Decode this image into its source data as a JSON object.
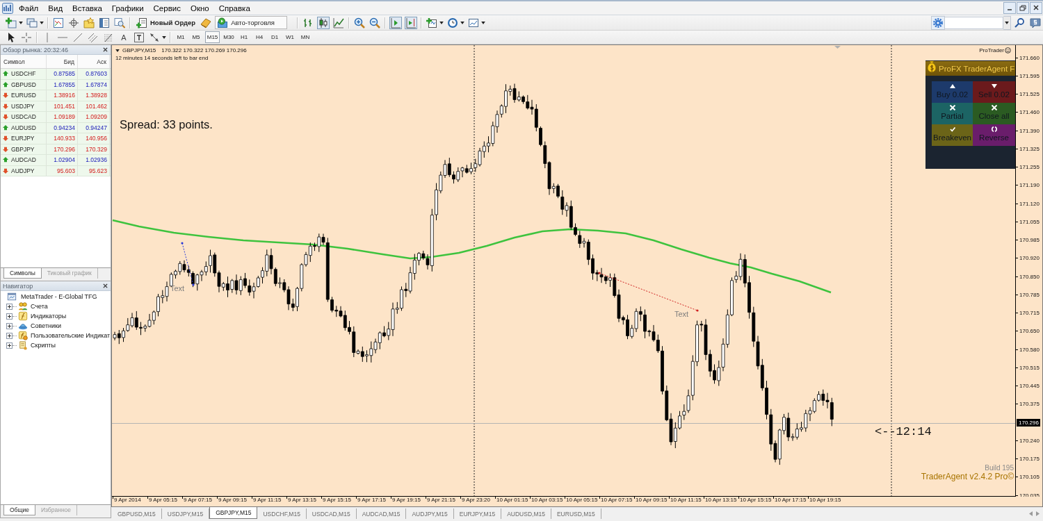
{
  "menu": [
    "Файл",
    "Вид",
    "Вставка",
    "Графики",
    "Сервис",
    "Окно",
    "Справка"
  ],
  "toolbar": {
    "new_order": "Новый Ордер",
    "auto_trading": "Авто-торговля",
    "chart_modes": [
      {
        "selected": false
      },
      {
        "selected": true
      },
      {
        "selected": false
      }
    ],
    "shift_on": true,
    "autoscroll_on": true,
    "text_tool": "A",
    "timeframes": [
      {
        "label": "M1",
        "selected": false
      },
      {
        "label": "M5",
        "selected": false
      },
      {
        "label": "M15",
        "selected": true
      },
      {
        "label": "M30",
        "selected": false
      },
      {
        "label": "H1",
        "selected": false
      },
      {
        "label": "H4",
        "selected": false
      },
      {
        "label": "D1",
        "selected": false
      },
      {
        "label": "W1",
        "selected": false
      },
      {
        "label": "MN",
        "selected": false
      }
    ]
  },
  "market_watch": {
    "title": "Обзор рынка: 20:32:46",
    "columns": [
      "Символ",
      "Бид",
      "Аск"
    ],
    "rows": [
      {
        "symbol": "USDCHF",
        "bid": "0.87585",
        "ask": "0.87603",
        "kind": "up"
      },
      {
        "symbol": "GBPUSD",
        "bid": "1.67855",
        "ask": "1.67874",
        "kind": "up"
      },
      {
        "symbol": "EURUSD",
        "bid": "1.38916",
        "ask": "1.38928",
        "kind": "down"
      },
      {
        "symbol": "USDJPY",
        "bid": "101.451",
        "ask": "101.462",
        "kind": "down"
      },
      {
        "symbol": "USDCAD",
        "bid": "1.09189",
        "ask": "1.09209",
        "kind": "down"
      },
      {
        "symbol": "AUDUSD",
        "bid": "0.94234",
        "ask": "0.94247",
        "kind": "up"
      },
      {
        "symbol": "EURJPY",
        "bid": "140.933",
        "ask": "140.956",
        "kind": "down"
      },
      {
        "symbol": "GBPJPY",
        "bid": "170.296",
        "ask": "170.329",
        "kind": "down"
      },
      {
        "symbol": "AUDCAD",
        "bid": "1.02904",
        "ask": "1.02936",
        "kind": "up"
      },
      {
        "symbol": "AUDJPY",
        "bid": "95.603",
        "ask": "95.623",
        "kind": "down"
      }
    ],
    "tabs": [
      {
        "label": "Символы",
        "selected": true
      },
      {
        "label": "Тиковый график",
        "selected": false
      }
    ]
  },
  "navigator": {
    "title": "Навигатор",
    "tree": [
      {
        "label": "MetaTrader - E-Global TFG",
        "children": [
          {
            "label": "Счета",
            "expanded": false
          },
          {
            "label": "Индикаторы",
            "expanded": false
          },
          {
            "label": "Советники",
            "expanded": false
          },
          {
            "label": "Пользовательские Индикат",
            "expanded": false
          },
          {
            "label": "Скрипты",
            "expanded": false
          }
        ]
      }
    ],
    "tabs": [
      {
        "label": "Общие",
        "selected": true
      },
      {
        "label": "Избранное",
        "selected": false
      }
    ]
  },
  "chart": {
    "symbol": "GBPJPY,M15",
    "ohlc": "170.322 170.322 170.269 170.296",
    "timer": "12 minutes 14 seconds left to bar end",
    "spread": "Spread: 33 points.",
    "countdown": "<--12:14",
    "brand": "ProTrader",
    "object_labels": [
      "Text",
      "Text"
    ],
    "price_scale": {
      "ticks_above": [
        "171.660",
        "171.595",
        "171.525",
        "171.460",
        "171.390",
        "171.325",
        "171.255",
        "171.190",
        "171.120",
        "171.055",
        "170.985",
        "170.920",
        "170.850",
        "170.785",
        "170.715",
        "170.650",
        "170.580",
        "170.515",
        "170.445",
        "170.375"
      ],
      "current_price": "170.296",
      "ticks_below": [
        "170.240",
        "170.175",
        "170.105",
        "170.035"
      ]
    },
    "time_labels": [
      "9 Apr 2014",
      "9 Apr 05:15",
      "9 Apr 07:15",
      "9 Apr 09:15",
      "9 Apr 11:15",
      "9 Apr 13:15",
      "9 Apr 15:15",
      "9 Apr 17:15",
      "9 Apr 19:15",
      "9 Apr 21:15",
      "9 Apr 23:20",
      "10 Apr 01:15",
      "10 Apr 03:15",
      "10 Apr 05:15",
      "10 Apr 07:15",
      "10 Apr 09:15",
      "10 Apr 11:15",
      "10 Apr 13:15",
      "10 Apr 15:15",
      "10 Apr 17:15",
      "10 Apr 19:15"
    ],
    "panel": {
      "title": "ProFX TraderAgent F",
      "buttons": [
        {
          "kind": "buy",
          "label": "Buy 0.02",
          "color": "#1d3a6b"
        },
        {
          "kind": "sell",
          "label": "Sell 0.02",
          "color": "#6b1a1c"
        },
        {
          "kind": "partial",
          "label": "Partial",
          "color": "#1c6464"
        },
        {
          "kind": "close",
          "label": "Close all",
          "color": "#2b5b22"
        },
        {
          "kind": "breakeven",
          "label": "Breakeven",
          "color": "#6b6418"
        },
        {
          "kind": "reverse",
          "label": "Reverse",
          "color": "#6a1d6b"
        }
      ]
    },
    "build": "Build 195",
    "version": "TraderAgent v2.4.2 Pro©"
  },
  "chart_tabs": [
    {
      "label": "GBPUSD,M15",
      "selected": false
    },
    {
      "label": "USDJPY,M15",
      "selected": false
    },
    {
      "label": "GBPJPY,M15",
      "selected": true
    },
    {
      "label": "USDCHF,M15",
      "selected": false
    },
    {
      "label": "USDCAD,M15",
      "selected": false
    },
    {
      "label": "AUDCAD,M15",
      "selected": false
    },
    {
      "label": "AUDJPY,M15",
      "selected": false
    },
    {
      "label": "EURJPY,M15",
      "selected": false
    },
    {
      "label": "AUDUSD,M15",
      "selected": false
    },
    {
      "label": "EURUSD,M15",
      "selected": false
    }
  ]
}
